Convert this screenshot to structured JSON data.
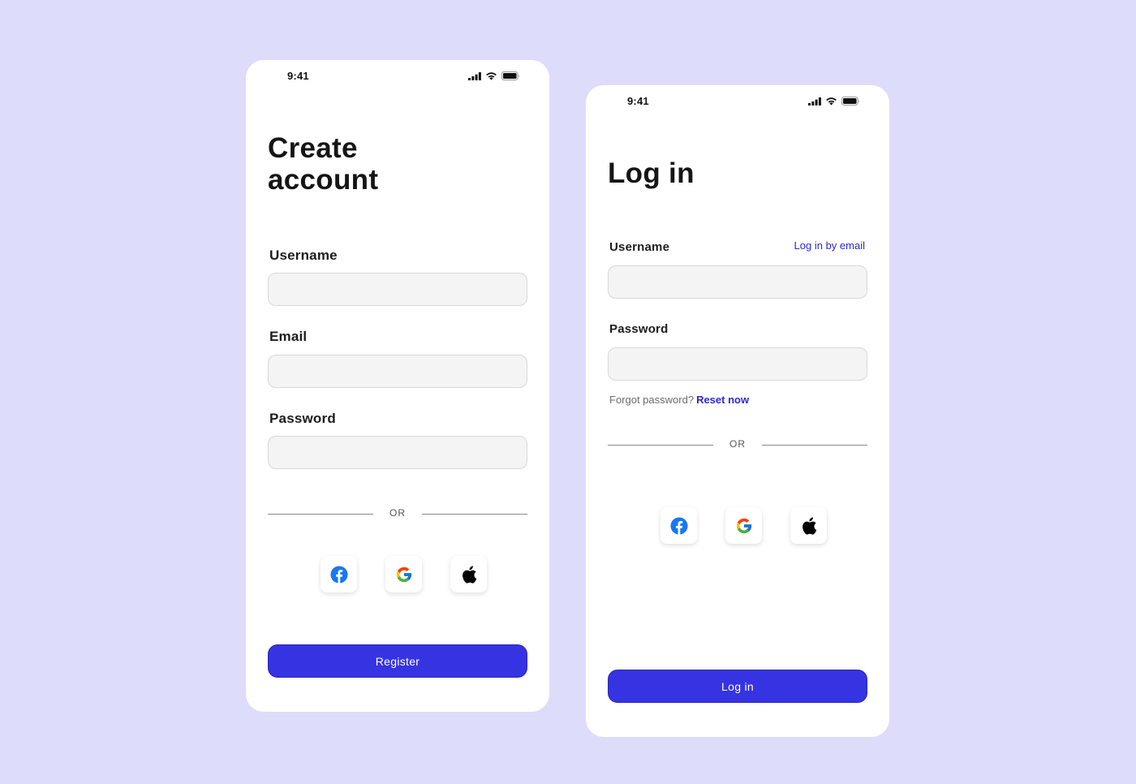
{
  "colors": {
    "background": "#dedcfb",
    "card": "#ffffff",
    "accent": "#3633e3",
    "link": "#2b27d8",
    "input_bg": "#f4f4f4"
  },
  "register_screen": {
    "status_time": "9:41",
    "title_line1": "Create",
    "title_line2": "account",
    "username_label": "Username",
    "username_value": "",
    "email_label": "Email",
    "email_value": "",
    "password_label": "Password",
    "password_value": "",
    "divider_text": "OR",
    "social_icons": [
      "facebook-icon",
      "google-icon",
      "apple-icon"
    ],
    "submit_label": "Register"
  },
  "login_screen": {
    "status_time": "9:41",
    "title": "Log in",
    "username_label": "Username",
    "login_by_email_link": "Log in by email",
    "username_value": "",
    "password_label": "Password",
    "password_value": "",
    "forgot_text": "Forgot password?",
    "reset_link": "Reset now",
    "divider_text": "OR",
    "social_icons": [
      "facebook-icon",
      "google-icon",
      "apple-icon"
    ],
    "submit_label": "Log in"
  }
}
